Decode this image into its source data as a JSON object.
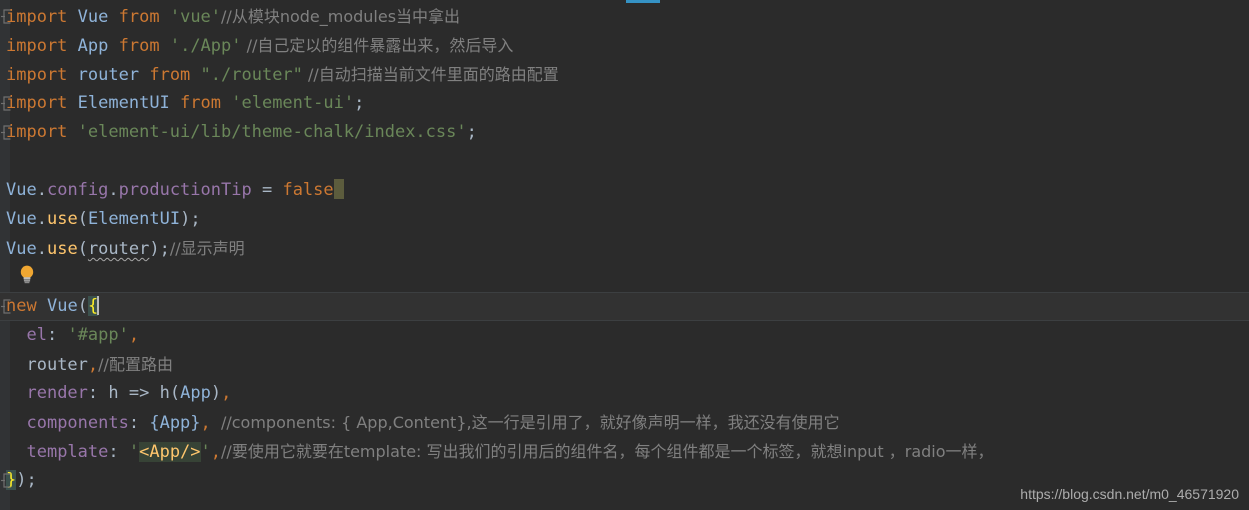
{
  "editor": {
    "theme": "darcula",
    "background": "#2b2b2b",
    "current_line_background": "#323232",
    "gutter_background": "#313335",
    "accent": "#3592c4",
    "caret_color": "#bbbbbb",
    "colors": {
      "keyword": "#cc7832",
      "identifier": "#a9b7c6",
      "class": "#8fb3d9",
      "string": "#6a8759",
      "comment": "#808080",
      "property": "#9876aa",
      "function": "#ffc66d",
      "number": "#6897bb",
      "brace_match_bg": "#3b514d",
      "brace_match_fg": "#ffef28",
      "template_highlight_bg": "#374336",
      "template_highlight_fg": "#ffc66d"
    }
  },
  "icons": {
    "intention_bulb": "lightbulb-icon",
    "fold_collapse": "fold-marker-icon"
  },
  "watermark": {
    "text": "https://blog.csdn.net/m0_46571920"
  },
  "code": {
    "language": "javascript",
    "filename_context": "main.js",
    "lines": [
      {
        "n": 1,
        "fold": true,
        "tokens": [
          {
            "t": "import",
            "c": "kw"
          },
          {
            "t": " ",
            "c": "punct"
          },
          {
            "t": "Vue",
            "c": "cls"
          },
          {
            "t": " ",
            "c": "punct"
          },
          {
            "t": "from",
            "c": "kw"
          },
          {
            "t": " ",
            "c": "punct"
          },
          {
            "t": "'vue'",
            "c": "str"
          },
          {
            "t": "//从模块node_modules当中拿出",
            "c": "cmt"
          }
        ]
      },
      {
        "n": 2,
        "fold": false,
        "tokens": [
          {
            "t": "import",
            "c": "kw"
          },
          {
            "t": " ",
            "c": "punct"
          },
          {
            "t": "App",
            "c": "cls"
          },
          {
            "t": " ",
            "c": "punct"
          },
          {
            "t": "from",
            "c": "kw"
          },
          {
            "t": " ",
            "c": "punct"
          },
          {
            "t": "'./App'",
            "c": "str"
          },
          {
            "t": " //自己定以的组件暴露出来，然后导入",
            "c": "cmt"
          }
        ]
      },
      {
        "n": 3,
        "fold": false,
        "tokens": [
          {
            "t": "import",
            "c": "kw"
          },
          {
            "t": " ",
            "c": "punct"
          },
          {
            "t": "router",
            "c": "cls"
          },
          {
            "t": " ",
            "c": "punct"
          },
          {
            "t": "from",
            "c": "kw"
          },
          {
            "t": " ",
            "c": "punct"
          },
          {
            "t": "\"./router\"",
            "c": "str"
          },
          {
            "t": " //自动扫描当前文件里面的路由配置",
            "c": "cmt"
          }
        ]
      },
      {
        "n": 4,
        "fold": true,
        "tokens": [
          {
            "t": "import",
            "c": "kw"
          },
          {
            "t": " ",
            "c": "punct"
          },
          {
            "t": "ElementUI",
            "c": "cls"
          },
          {
            "t": " ",
            "c": "punct"
          },
          {
            "t": "from",
            "c": "kw"
          },
          {
            "t": " ",
            "c": "punct"
          },
          {
            "t": "'element-ui'",
            "c": "str"
          },
          {
            "t": ";",
            "c": "punct"
          }
        ]
      },
      {
        "n": 5,
        "fold": true,
        "tokens": [
          {
            "t": "import",
            "c": "kw"
          },
          {
            "t": " ",
            "c": "punct"
          },
          {
            "t": "'element-ui/lib/theme-chalk/index.css'",
            "c": "str"
          },
          {
            "t": ";",
            "c": "punct"
          }
        ]
      },
      {
        "n": 6,
        "fold": false,
        "tokens": []
      },
      {
        "n": 7,
        "fold": false,
        "caret_block": true,
        "tokens": [
          {
            "t": "Vue",
            "c": "cls"
          },
          {
            "t": ".",
            "c": "punct"
          },
          {
            "t": "config",
            "c": "prop"
          },
          {
            "t": ".",
            "c": "punct"
          },
          {
            "t": "productionTip",
            "c": "prop"
          },
          {
            "t": " ",
            "c": "punct"
          },
          {
            "t": "=",
            "c": "punct"
          },
          {
            "t": " ",
            "c": "punct"
          },
          {
            "t": "false",
            "c": "kw"
          }
        ]
      },
      {
        "n": 8,
        "fold": false,
        "tokens": [
          {
            "t": "Vue",
            "c": "cls"
          },
          {
            "t": ".",
            "c": "punct"
          },
          {
            "t": "use",
            "c": "func"
          },
          {
            "t": "(",
            "c": "punct"
          },
          {
            "t": "ElementUI",
            "c": "cls"
          },
          {
            "t": ")",
            "c": "punct"
          },
          {
            "t": ";",
            "c": "punct"
          }
        ]
      },
      {
        "n": 9,
        "fold": false,
        "tokens": [
          {
            "t": "Vue",
            "c": "cls"
          },
          {
            "t": ".",
            "c": "punct"
          },
          {
            "t": "use",
            "c": "func"
          },
          {
            "t": "(",
            "c": "punct"
          },
          {
            "t": "router",
            "c": "ident wavy"
          },
          {
            "t": ")",
            "c": "punct"
          },
          {
            "t": ";",
            "c": "punct"
          },
          {
            "t": "//显示声明",
            "c": "cmt"
          }
        ]
      },
      {
        "n": 10,
        "fold": false,
        "tokens": []
      },
      {
        "n": 11,
        "fold": true,
        "current": true,
        "tokens": [
          {
            "t": "new",
            "c": "kw"
          },
          {
            "t": " ",
            "c": "punct"
          },
          {
            "t": "Vue",
            "c": "cls"
          },
          {
            "t": "(",
            "c": "punct"
          },
          {
            "t": "{",
            "c": "brace-hl"
          }
        ]
      },
      {
        "n": 12,
        "fold": false,
        "indent": 2,
        "tokens": [
          {
            "t": "el",
            "c": "prop"
          },
          {
            "t": ": ",
            "c": "punct"
          },
          {
            "t": "'#app'",
            "c": "str"
          },
          {
            "t": ",",
            "c": "comma"
          }
        ]
      },
      {
        "n": 13,
        "fold": false,
        "indent": 2,
        "tokens": [
          {
            "t": "router",
            "c": "ident"
          },
          {
            "t": ",",
            "c": "comma"
          },
          {
            "t": "//配置路由",
            "c": "cmt"
          }
        ]
      },
      {
        "n": 14,
        "fold": false,
        "indent": 2,
        "tokens": [
          {
            "t": "render",
            "c": "prop"
          },
          {
            "t": ": ",
            "c": "punct"
          },
          {
            "t": "h",
            "c": "ident"
          },
          {
            "t": " => ",
            "c": "punct"
          },
          {
            "t": "h",
            "c": "ident"
          },
          {
            "t": "(",
            "c": "punct"
          },
          {
            "t": "App",
            "c": "cls"
          },
          {
            "t": ")",
            "c": "punct"
          },
          {
            "t": ",",
            "c": "comma"
          }
        ]
      },
      {
        "n": 15,
        "fold": false,
        "indent": 2,
        "tokens": [
          {
            "t": "components",
            "c": "prop"
          },
          {
            "t": ": ",
            "c": "punct"
          },
          {
            "t": "{",
            "c": "cls"
          },
          {
            "t": "App",
            "c": "cls"
          },
          {
            "t": "}",
            "c": "cls"
          },
          {
            "t": ",",
            "c": "comma"
          },
          {
            "t": "  //components: { App,Content},这一行是引用了，就好像声明一样，我还没有使用它",
            "c": "cmt"
          }
        ]
      },
      {
        "n": 16,
        "fold": false,
        "indent": 2,
        "tokens": [
          {
            "t": "template",
            "c": "prop"
          },
          {
            "t": ": ",
            "c": "punct"
          },
          {
            "t": "'",
            "c": "str"
          },
          {
            "t": "<App/>",
            "c": "tpl-hl"
          },
          {
            "t": "'",
            "c": "str"
          },
          {
            "t": ",",
            "c": "comma"
          },
          {
            "t": "//要使用它就要在template: 写出我们的引用后的组件名，每个组件都是一个标签，就想input ，radio一样，",
            "c": "cmt"
          }
        ]
      },
      {
        "n": 17,
        "fold": true,
        "tokens": [
          {
            "t": "}",
            "c": "brace-hl"
          },
          {
            "t": ")",
            "c": "paren"
          },
          {
            "t": ";",
            "c": "punct"
          }
        ]
      }
    ]
  }
}
